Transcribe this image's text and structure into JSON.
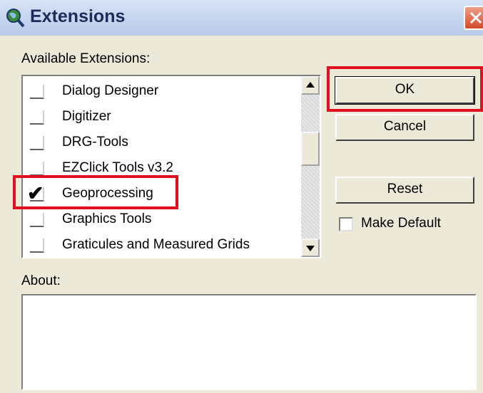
{
  "window": {
    "title": "Extensions"
  },
  "available_label": "Available Extensions:",
  "extensions": [
    {
      "label": "Dialog Designer",
      "checked": false
    },
    {
      "label": "Digitizer",
      "checked": false
    },
    {
      "label": "DRG-Tools",
      "checked": false
    },
    {
      "label": "EZClick Tools v3.2",
      "checked": false
    },
    {
      "label": "Geoprocessing",
      "checked": true
    },
    {
      "label": "Graphics Tools",
      "checked": false
    },
    {
      "label": "Graticules and Measured Grids",
      "checked": false
    }
  ],
  "buttons": {
    "ok": "OK",
    "cancel": "Cancel",
    "reset": "Reset"
  },
  "make_default": {
    "label": "Make Default",
    "checked": false
  },
  "about_label": "About:",
  "about_text": "",
  "highlight_color": "#e01020",
  "icons": {
    "title": "globe-magnifier-icon",
    "close": "close-icon",
    "check": "check-mark"
  }
}
